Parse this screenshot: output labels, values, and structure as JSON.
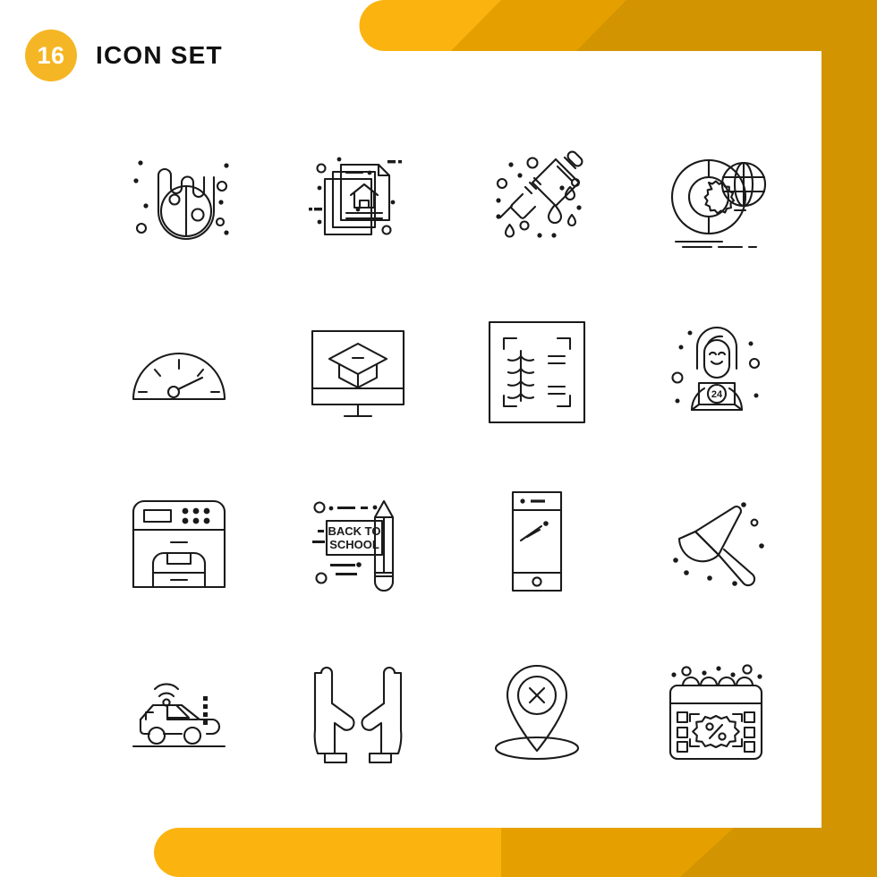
{
  "page": {
    "background_color": "#ffffff",
    "panel_color": "#ffffff"
  },
  "decor": {
    "color_light": "#FBB310",
    "color_mid": "#E5A000",
    "color_dark": "#D29400",
    "badge_color": "#F5B625",
    "stroke_color": "#1a1a1a"
  },
  "header": {
    "badge_count": "16",
    "title": "Icon Set"
  },
  "grid": {
    "columns": 4,
    "rows": 4,
    "total": 16,
    "icons": [
      {
        "index": 1,
        "name": "meteor-comet-icon",
        "label": "Meteor"
      },
      {
        "index": 2,
        "name": "real-estate-document-icon",
        "label": "Real Estate Documents"
      },
      {
        "index": 3,
        "name": "syringe-vaccine-icon",
        "label": "Syringe"
      },
      {
        "index": 4,
        "name": "global-settings-chart-icon",
        "label": "Global Settings Chart"
      },
      {
        "index": 5,
        "name": "speedometer-gauge-icon",
        "label": "Speedometer"
      },
      {
        "index": 6,
        "name": "online-education-icon",
        "label": "Online Education"
      },
      {
        "index": 7,
        "name": "crop-scan-icon",
        "label": "Crop Scan"
      },
      {
        "index": 8,
        "name": "customer-support-icon",
        "label": "Customer Support 24"
      },
      {
        "index": 9,
        "name": "printer-copier-icon",
        "label": "Printer"
      },
      {
        "index": 10,
        "name": "back-to-school-icon",
        "label": "Back To School"
      },
      {
        "index": 11,
        "name": "smartphone-icon",
        "label": "Smartphone"
      },
      {
        "index": 12,
        "name": "dustpan-cleaning-icon",
        "label": "Dustpan"
      },
      {
        "index": 13,
        "name": "smart-car-icon",
        "label": "Smart Car"
      },
      {
        "index": 14,
        "name": "caring-hands-icon",
        "label": "Caring Hands"
      },
      {
        "index": 15,
        "name": "location-pin-cancel-icon",
        "label": "Location Unavailable"
      },
      {
        "index": 16,
        "name": "discount-calendar-icon",
        "label": "Discount Calendar"
      }
    ]
  },
  "glyphs": {
    "support_badge": "24",
    "back_to_school_line1": "BACK TO",
    "back_to_school_line2": "SCHOOL",
    "percent_symbol": "%",
    "cancel_symbol": "X"
  }
}
